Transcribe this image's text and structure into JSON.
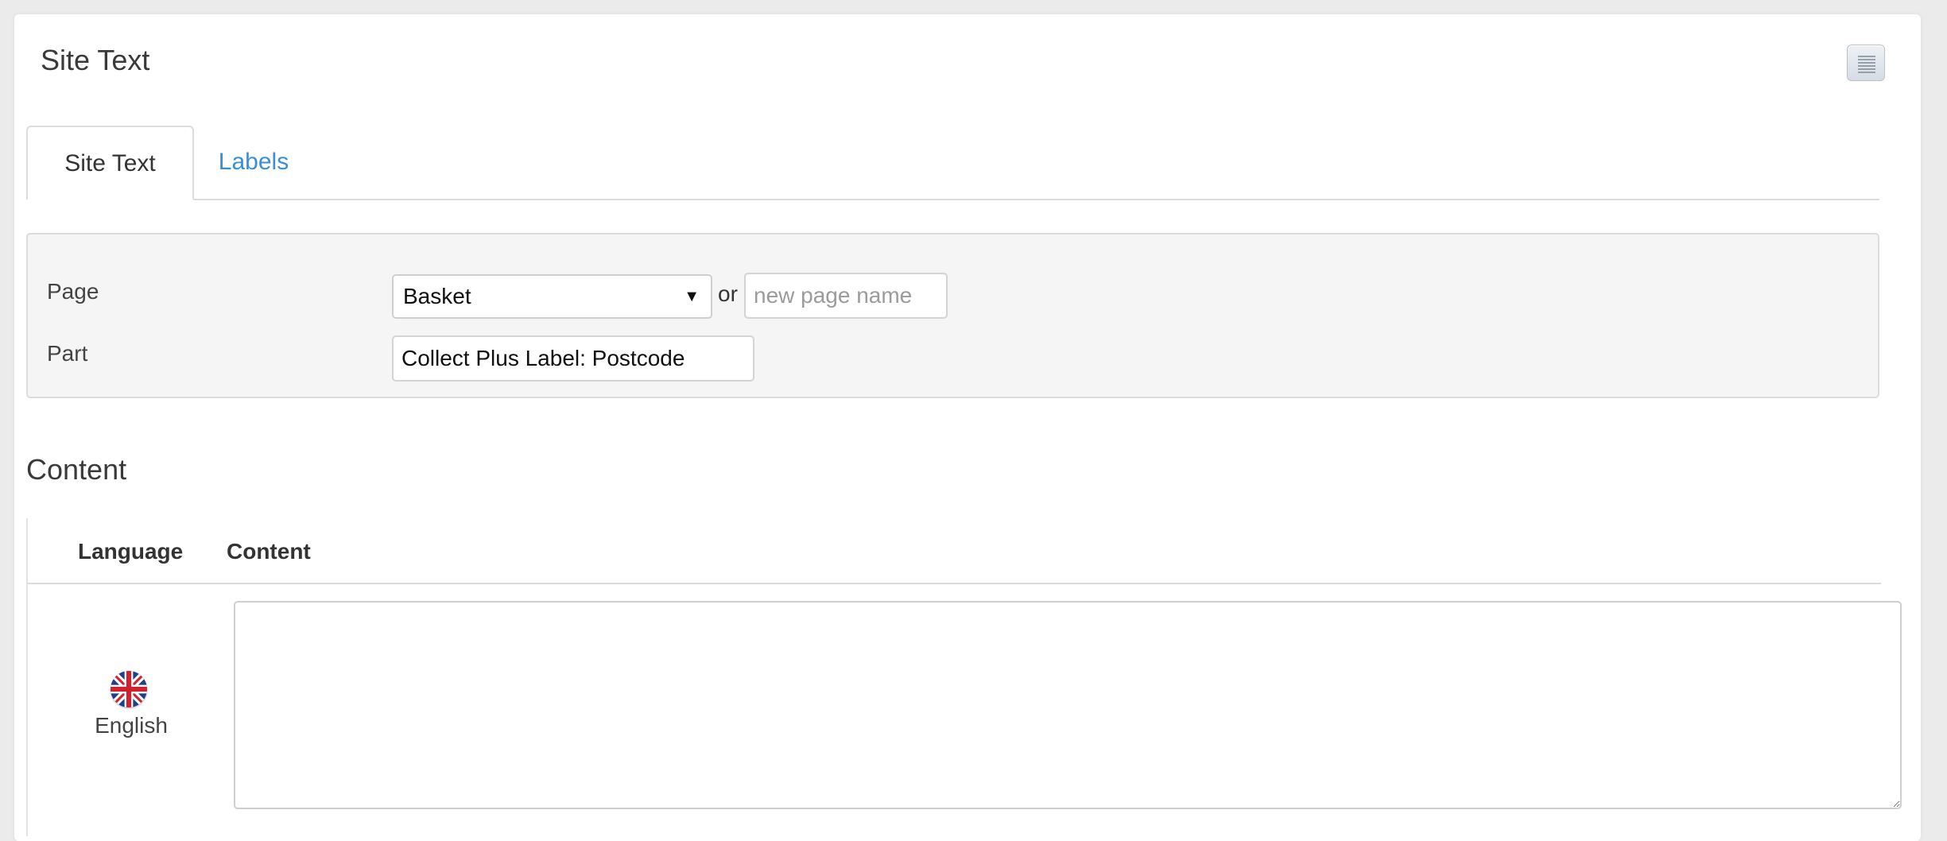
{
  "panel": {
    "title": "Site Text"
  },
  "tabs": [
    {
      "label": "Site Text",
      "active": true
    },
    {
      "label": "Labels",
      "active": false
    }
  ],
  "form": {
    "page_label": "Page",
    "page_selected": "Basket",
    "or_text": "or",
    "new_page_placeholder": "new page name",
    "new_page_value": "",
    "part_label": "Part",
    "part_value": "Collect Plus Label: Postcode"
  },
  "content": {
    "section_title": "Content",
    "columns": [
      "Language",
      "Content"
    ],
    "rows": [
      {
        "language": "English",
        "flag_icon": "uk-flag-icon",
        "content": ""
      }
    ]
  },
  "colors": {
    "link": "#3a8ed7",
    "form_bg": "#f5f5f5",
    "border": "#dcdcdc"
  }
}
